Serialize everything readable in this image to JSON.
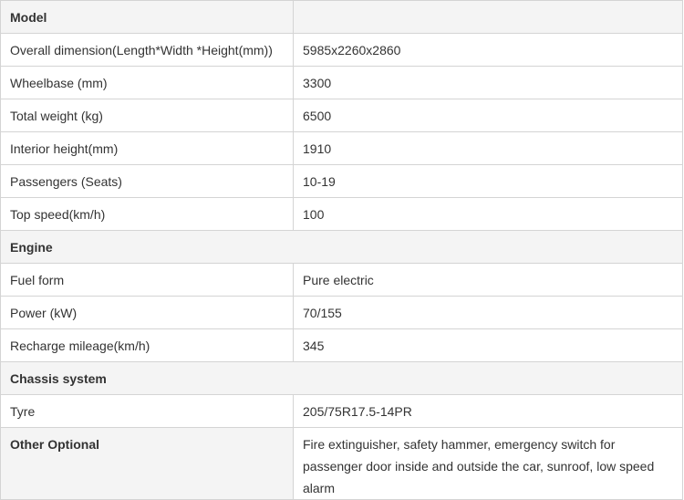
{
  "rows": [
    {
      "label": "Model",
      "value": "",
      "type": "header"
    },
    {
      "label": "Overall dimension(Length*Width *Height(mm))",
      "value": "5985x2260x2860"
    },
    {
      "label": "Wheelbase (mm)",
      "value": "3300"
    },
    {
      "label": "Total weight (kg)",
      "value": "6500"
    },
    {
      "label": "Interior height(mm)",
      "value": "1910"
    },
    {
      "label": "Passengers (Seats)",
      "value": "10-19"
    },
    {
      "label": "Top speed(km/h)",
      "value": "100"
    },
    {
      "label": "Engine",
      "type": "section"
    },
    {
      "label": "Fuel form",
      "value": "Pure electric"
    },
    {
      "label": "Power (kW)",
      "value": "70/155"
    },
    {
      "label": "Recharge mileage(km/h)",
      "value": "345"
    },
    {
      "label": "Chassis system",
      "type": "section"
    },
    {
      "label": "Tyre",
      "value": "205/75R17.5-14PR"
    },
    {
      "label": "Other Optional",
      "value": "Fire extinguisher, safety hammer, emergency switch for passenger door inside and outside the car, sunroof, low speed alarm",
      "type": "optional"
    }
  ]
}
